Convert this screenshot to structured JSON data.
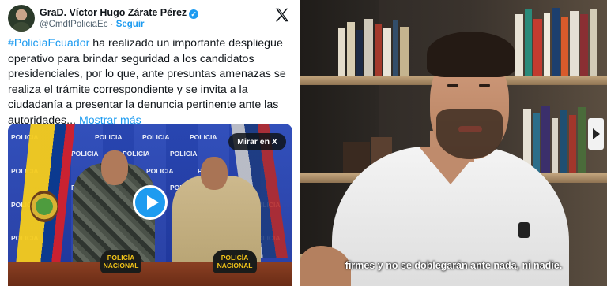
{
  "tweet": {
    "author_name": "GraD. Víctor Hugo Zárate Pérez",
    "handle": "@CmdtPoliciaEc",
    "separator": "·",
    "follow_label": "Seguir",
    "hashtag": "#PolicíaEcuador",
    "body": " ha realizado un importante despliegue operativo para brindar seguridad a los candidatos presidenciales, por lo que, ante presuntas amenazas se realiza el trámite correspondiente y se invita a la ciudadanía a presentar la denuncia pertinente ante las autoridades...",
    "more_label": "Mostrar más",
    "media": {
      "watch_label": "Mirar en X",
      "wall_word": "POLICIA",
      "hat_text": "POLICÍA\nNACIONAL"
    }
  },
  "video": {
    "subtitle": "firmes y no se doblegarán ante nada, ni nadie."
  },
  "colors": {
    "accent": "#1d9bf0",
    "text": "#0f1419",
    "muted": "#536471"
  }
}
